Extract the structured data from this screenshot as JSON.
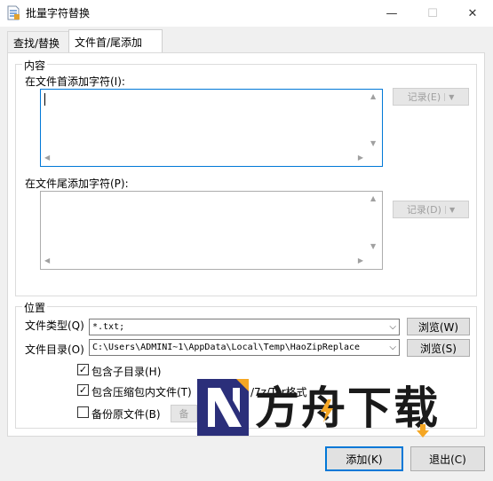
{
  "window": {
    "title": "批量字符替换",
    "minimize_glyph": "—",
    "maximize_glyph": "☐",
    "close_glyph": "✕"
  },
  "tabs": [
    {
      "label": "查找/替换",
      "active": false
    },
    {
      "label": "文件首/尾添加",
      "active": true
    }
  ],
  "content_group": {
    "title": "内容",
    "head_label": "在文件首添加字符(I):",
    "head_value": "",
    "head_record_button": "记录(E)",
    "tail_label": "在文件尾添加字符(P):",
    "tail_value": "",
    "tail_record_button": "记录(D)"
  },
  "location_group": {
    "title": "位置",
    "file_type_label": "文件类型(Q)",
    "file_type_value": "*.txt;",
    "browse_w": "浏览(W)",
    "file_dir_label": "文件目录(O)",
    "file_dir_value": "C:\\Users\\ADMINI~1\\AppData\\Local\\Temp\\HaoZipReplace",
    "browse_s": "浏览(S)",
    "include_subdirs": {
      "label": "包含子目录(H)",
      "checked": true
    },
    "include_archives": {
      "label": "包含压缩包内文件(T)",
      "suffix": "/7z/Tar格式",
      "checked": true
    },
    "backup_original": {
      "label": "备份原文件(B)",
      "checked": false
    },
    "backup_button": "备"
  },
  "footer": {
    "add_button": "添加(K)",
    "exit_button": "退出(C)"
  },
  "watermark": {
    "text": "方舟下载",
    "colors": {
      "navy": "#2b2f7a",
      "orange": "#f5a623",
      "text": "#1a1a1a"
    }
  },
  "colors": {
    "accent": "#0078d7"
  },
  "icons": {
    "dropdown": "▼",
    "combo_caret": "⌵",
    "checkmark": "✓"
  }
}
